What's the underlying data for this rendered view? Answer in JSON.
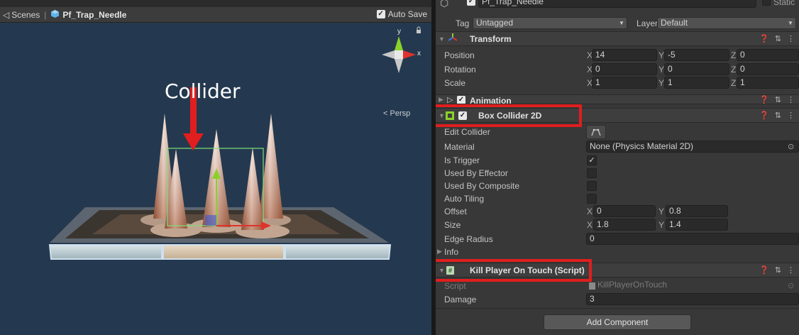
{
  "scene": {
    "breadcrumb_root": "Scenes",
    "breadcrumb_object": "Pf_Trap_Needle",
    "autosave_label": "Auto Save",
    "annotation": "Collider",
    "persp_label": "Persp",
    "gizmo_x": "x",
    "gizmo_y": "y"
  },
  "inspector": {
    "object_name": "Pf_Trap_Needle",
    "static_label": "Static",
    "tag_label": "Tag",
    "tag_value": "Untagged",
    "layer_label": "Layer",
    "layer_value": "Default",
    "transform": {
      "title": "Transform",
      "rows": [
        {
          "label": "Position",
          "x": "14",
          "y": "-5",
          "z": "0"
        },
        {
          "label": "Rotation",
          "x": "0",
          "y": "0",
          "z": "0"
        },
        {
          "label": "Scale",
          "x": "1",
          "y": "1",
          "z": "1"
        }
      ]
    },
    "animation": {
      "title": "Animation"
    },
    "box_collider": {
      "title": "Box Collider 2D",
      "edit_collider_label": "Edit Collider",
      "material_label": "Material",
      "material_value": "None (Physics Material 2D)",
      "is_trigger_label": "Is Trigger",
      "is_trigger": true,
      "used_by_effector_label": "Used By Effector",
      "used_by_composite_label": "Used By Composite",
      "auto_tiling_label": "Auto Tiling",
      "offset_label": "Offset",
      "offset_x": "0",
      "offset_y": "0.8",
      "size_label": "Size",
      "size_x": "1.8",
      "size_y": "1.4",
      "edge_radius_label": "Edge Radius",
      "edge_radius_value": "0",
      "info_label": "Info"
    },
    "kill_script": {
      "title": "Kill Player On Touch (Script)",
      "script_label": "Script",
      "script_value": "KillPlayerOnTouch",
      "damage_label": "Damage",
      "damage_value": "3"
    },
    "axis_labels": {
      "x": "X",
      "y": "Y",
      "z": "Z"
    },
    "add_component_label": "Add Component"
  },
  "colors": {
    "scene_bg": "#24394f",
    "inspector_bg": "#383838",
    "highlight_red": "#e01e1e",
    "gizmo_x_red": "#e0322c",
    "gizmo_y_green": "#8ad12b"
  }
}
